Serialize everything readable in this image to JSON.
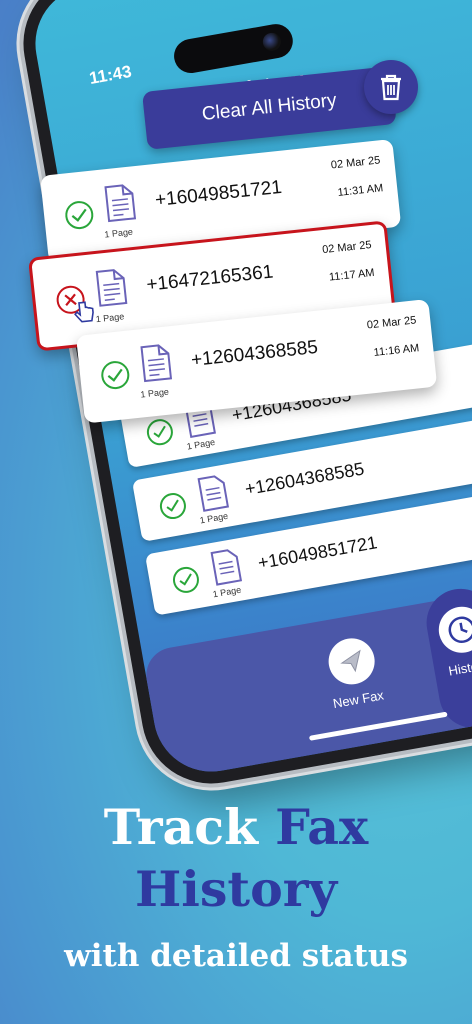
{
  "status_bar": {
    "time": "11:43"
  },
  "screen": {
    "title": "History"
  },
  "toolbar": {
    "clear_label": "Clear All History"
  },
  "history": [
    {
      "number": "+16049851721",
      "pages": "1 Page",
      "date": "02 Mar 25",
      "time": "11:31 AM",
      "status": "sent"
    },
    {
      "number": "+16472165361",
      "pages": "1 Page",
      "date": "02 Mar 25",
      "time": "11:17 AM",
      "status": "failed"
    },
    {
      "number": "+12604368585",
      "pages": "1 Page",
      "date": "02 Mar 25",
      "time": "11:16 AM",
      "status": "sent"
    }
  ],
  "background_history": [
    {
      "number": "+12604368585",
      "pages": "1 Page",
      "status": "sent"
    },
    {
      "number": "+12604368585",
      "pages": "1 Page",
      "status": "sent"
    },
    {
      "number": "+16049851721",
      "pages": "1 Page",
      "status": "sent"
    }
  ],
  "bottom_nav": {
    "new_fax_label": "New Fax",
    "history_label": "History"
  },
  "headline": {
    "line1_white": "Track",
    "line1_blue": "Fax",
    "line2_blue": "History",
    "line3": "with detailed status"
  },
  "colors": {
    "brand": "#3a3c9a",
    "success": "#2aa63a",
    "error": "#c7141c",
    "doc_icon": "#6a63b8"
  }
}
